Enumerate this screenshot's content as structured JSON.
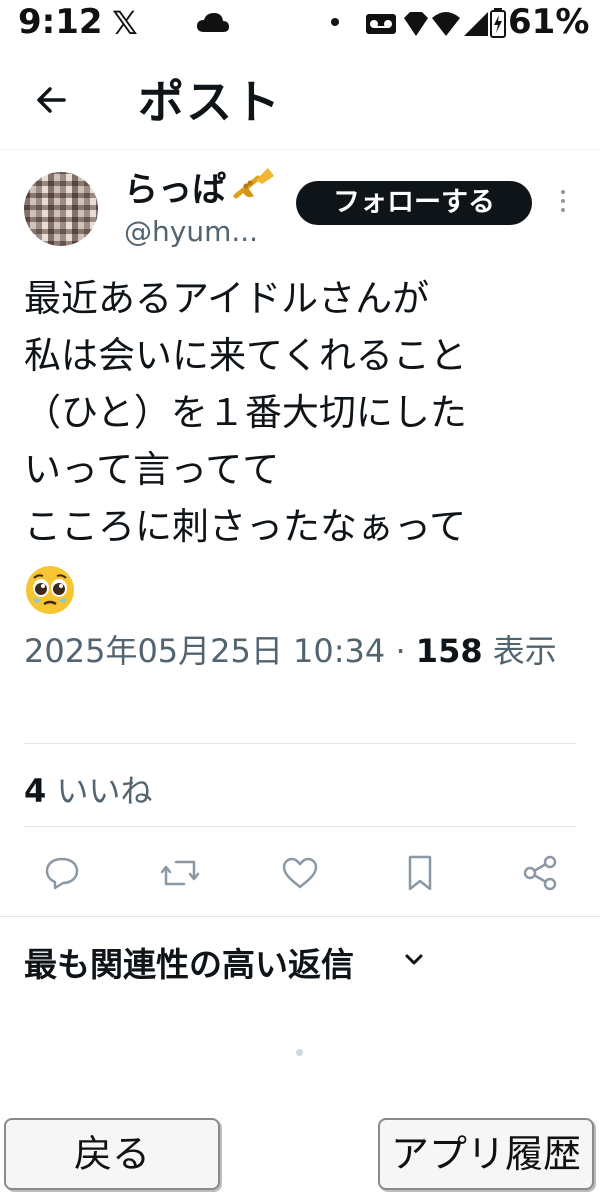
{
  "status_bar": {
    "time": "9:12",
    "x_logo": "𝕏",
    "battery_percent": "61%",
    "icons": [
      "cloud-icon",
      "notification-dot",
      "voicemail-icon",
      "diamond-icon",
      "wifi-icon",
      "signal-icon",
      "battery-icon"
    ]
  },
  "header": {
    "back_icon": "arrow-left-icon",
    "title": "ポスト"
  },
  "author": {
    "display_name": "らっぱ",
    "name_emoji": "trumpet-icon",
    "handle": "@hyum...",
    "follow_label": "フォローする",
    "more_icon": "vertical-dots-icon"
  },
  "post": {
    "text": "最近あるアイドルさんが\n私は会いに来てくれること\n（ひと）を１番大切にした\nいって言ってて\nこころに刺さったなぁって",
    "emoji": "pleading-face-icon",
    "timestamp": "2025年05月25日 10:34",
    "separator": " · ",
    "views_count": "158",
    "views_label": " 表示"
  },
  "engagement": {
    "likes_count": "4",
    "likes_label": " いいね"
  },
  "actions": [
    "reply-icon",
    "retweet-icon",
    "like-icon",
    "bookmark-icon",
    "share-icon"
  ],
  "replies": {
    "sort_label": "最も関連性の高い返信",
    "chevron": "chevron-down-icon"
  },
  "bottom_bar": {
    "back_label": "戻る",
    "history_label": "アプリ履歴"
  },
  "colors": {
    "text_primary": "#0f1419",
    "text_secondary": "#536471",
    "follow_bg": "#0f1419",
    "icon_gray": "#8b98a5",
    "divider": "#e1e8ed"
  }
}
